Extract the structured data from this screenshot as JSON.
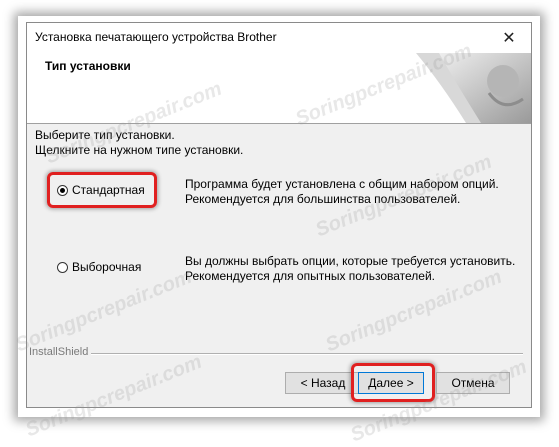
{
  "window": {
    "title": "Установка печатающего устройства Brother",
    "close_glyph": "✕"
  },
  "header": {
    "title": "Тип установки"
  },
  "instructions": {
    "line1": "Выберите тип установки.",
    "line2": "Щелкните на нужном типе установки."
  },
  "options": [
    {
      "label": "Стандартная",
      "selected": true,
      "desc1": "Программа будет установлена с общим набором опций.",
      "desc2": "Рекомендуется для большинства пользователей."
    },
    {
      "label": "Выборочная",
      "selected": false,
      "desc1": "Вы должны выбрать опции, которые требуется установить.",
      "desc2": "Рекомендуется для опытных пользователей."
    }
  ],
  "footer": {
    "brand": "InstallShield"
  },
  "buttons": {
    "back": "< Назад",
    "next": "Далее >",
    "cancel": "Отмена"
  },
  "watermark_text": "Soringpcrepair.com",
  "colors": {
    "highlight": "#e02020",
    "default_button_border": "#0078d7"
  }
}
